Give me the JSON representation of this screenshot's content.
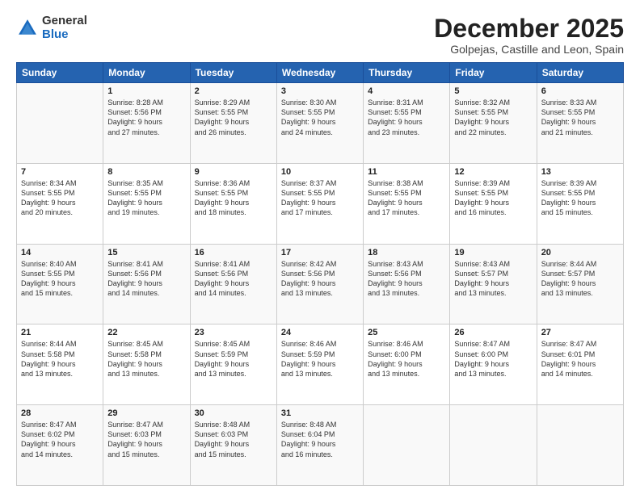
{
  "logo": {
    "general": "General",
    "blue": "Blue"
  },
  "title": "December 2025",
  "subtitle": "Golpejas, Castille and Leon, Spain",
  "days_of_week": [
    "Sunday",
    "Monday",
    "Tuesday",
    "Wednesday",
    "Thursday",
    "Friday",
    "Saturday"
  ],
  "weeks": [
    [
      {
        "num": "",
        "info": ""
      },
      {
        "num": "1",
        "info": "Sunrise: 8:28 AM\nSunset: 5:56 PM\nDaylight: 9 hours\nand 27 minutes."
      },
      {
        "num": "2",
        "info": "Sunrise: 8:29 AM\nSunset: 5:55 PM\nDaylight: 9 hours\nand 26 minutes."
      },
      {
        "num": "3",
        "info": "Sunrise: 8:30 AM\nSunset: 5:55 PM\nDaylight: 9 hours\nand 24 minutes."
      },
      {
        "num": "4",
        "info": "Sunrise: 8:31 AM\nSunset: 5:55 PM\nDaylight: 9 hours\nand 23 minutes."
      },
      {
        "num": "5",
        "info": "Sunrise: 8:32 AM\nSunset: 5:55 PM\nDaylight: 9 hours\nand 22 minutes."
      },
      {
        "num": "6",
        "info": "Sunrise: 8:33 AM\nSunset: 5:55 PM\nDaylight: 9 hours\nand 21 minutes."
      }
    ],
    [
      {
        "num": "7",
        "info": "Sunrise: 8:34 AM\nSunset: 5:55 PM\nDaylight: 9 hours\nand 20 minutes."
      },
      {
        "num": "8",
        "info": "Sunrise: 8:35 AM\nSunset: 5:55 PM\nDaylight: 9 hours\nand 19 minutes."
      },
      {
        "num": "9",
        "info": "Sunrise: 8:36 AM\nSunset: 5:55 PM\nDaylight: 9 hours\nand 18 minutes."
      },
      {
        "num": "10",
        "info": "Sunrise: 8:37 AM\nSunset: 5:55 PM\nDaylight: 9 hours\nand 17 minutes."
      },
      {
        "num": "11",
        "info": "Sunrise: 8:38 AM\nSunset: 5:55 PM\nDaylight: 9 hours\nand 17 minutes."
      },
      {
        "num": "12",
        "info": "Sunrise: 8:39 AM\nSunset: 5:55 PM\nDaylight: 9 hours\nand 16 minutes."
      },
      {
        "num": "13",
        "info": "Sunrise: 8:39 AM\nSunset: 5:55 PM\nDaylight: 9 hours\nand 15 minutes."
      }
    ],
    [
      {
        "num": "14",
        "info": "Sunrise: 8:40 AM\nSunset: 5:55 PM\nDaylight: 9 hours\nand 15 minutes."
      },
      {
        "num": "15",
        "info": "Sunrise: 8:41 AM\nSunset: 5:56 PM\nDaylight: 9 hours\nand 14 minutes."
      },
      {
        "num": "16",
        "info": "Sunrise: 8:41 AM\nSunset: 5:56 PM\nDaylight: 9 hours\nand 14 minutes."
      },
      {
        "num": "17",
        "info": "Sunrise: 8:42 AM\nSunset: 5:56 PM\nDaylight: 9 hours\nand 13 minutes."
      },
      {
        "num": "18",
        "info": "Sunrise: 8:43 AM\nSunset: 5:56 PM\nDaylight: 9 hours\nand 13 minutes."
      },
      {
        "num": "19",
        "info": "Sunrise: 8:43 AM\nSunset: 5:57 PM\nDaylight: 9 hours\nand 13 minutes."
      },
      {
        "num": "20",
        "info": "Sunrise: 8:44 AM\nSunset: 5:57 PM\nDaylight: 9 hours\nand 13 minutes."
      }
    ],
    [
      {
        "num": "21",
        "info": "Sunrise: 8:44 AM\nSunset: 5:58 PM\nDaylight: 9 hours\nand 13 minutes."
      },
      {
        "num": "22",
        "info": "Sunrise: 8:45 AM\nSunset: 5:58 PM\nDaylight: 9 hours\nand 13 minutes."
      },
      {
        "num": "23",
        "info": "Sunrise: 8:45 AM\nSunset: 5:59 PM\nDaylight: 9 hours\nand 13 minutes."
      },
      {
        "num": "24",
        "info": "Sunrise: 8:46 AM\nSunset: 5:59 PM\nDaylight: 9 hours\nand 13 minutes."
      },
      {
        "num": "25",
        "info": "Sunrise: 8:46 AM\nSunset: 6:00 PM\nDaylight: 9 hours\nand 13 minutes."
      },
      {
        "num": "26",
        "info": "Sunrise: 8:47 AM\nSunset: 6:00 PM\nDaylight: 9 hours\nand 13 minutes."
      },
      {
        "num": "27",
        "info": "Sunrise: 8:47 AM\nSunset: 6:01 PM\nDaylight: 9 hours\nand 14 minutes."
      }
    ],
    [
      {
        "num": "28",
        "info": "Sunrise: 8:47 AM\nSunset: 6:02 PM\nDaylight: 9 hours\nand 14 minutes."
      },
      {
        "num": "29",
        "info": "Sunrise: 8:47 AM\nSunset: 6:03 PM\nDaylight: 9 hours\nand 15 minutes."
      },
      {
        "num": "30",
        "info": "Sunrise: 8:48 AM\nSunset: 6:03 PM\nDaylight: 9 hours\nand 15 minutes."
      },
      {
        "num": "31",
        "info": "Sunrise: 8:48 AM\nSunset: 6:04 PM\nDaylight: 9 hours\nand 16 minutes."
      },
      {
        "num": "",
        "info": ""
      },
      {
        "num": "",
        "info": ""
      },
      {
        "num": "",
        "info": ""
      }
    ]
  ]
}
